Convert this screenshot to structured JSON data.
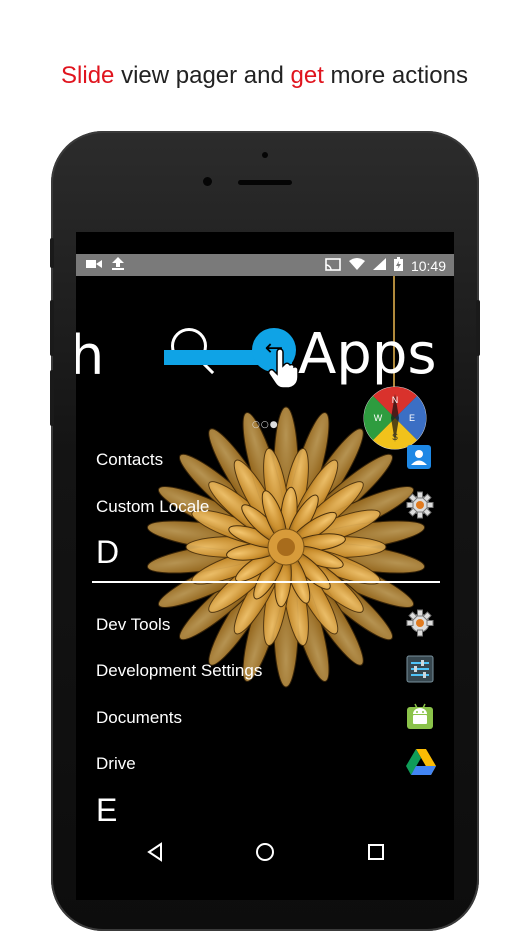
{
  "caption": {
    "part1": "Slide",
    "part2": " view pager and ",
    "part3": "get",
    "part4": " more actions"
  },
  "status_bar": {
    "time": "10:49",
    "left_icons": [
      "video-camera-icon",
      "upload-icon"
    ],
    "right_icons": [
      "cast-icon",
      "wifi-icon",
      "signal-icon",
      "battery-icon"
    ]
  },
  "header": {
    "left_letter": "h",
    "title": "Apps",
    "pager_dots": "○○●"
  },
  "compass": {
    "n": "N",
    "e": "E",
    "s": "S",
    "w": "W"
  },
  "sections": {
    "d_letter": "D",
    "e_letter": "E"
  },
  "apps": {
    "contacts": "Contacts",
    "custom_locale": "Custom Locale",
    "dev_tools": "Dev Tools",
    "development_settings": "Development Settings",
    "documents": "Documents",
    "drive": "Drive"
  },
  "colors": {
    "accent_red": "#e0141e",
    "swipe_blue": "#0fa3e6"
  }
}
